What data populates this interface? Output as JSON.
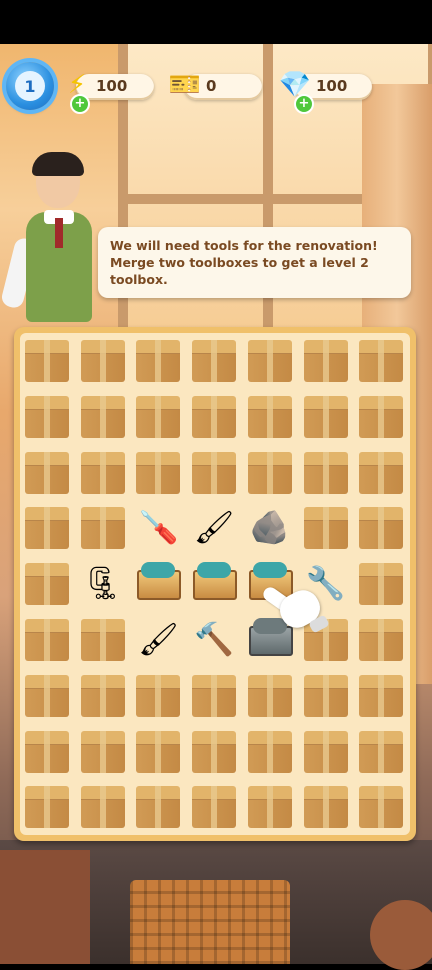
{
  "hud": {
    "level": "1",
    "energy": "100",
    "tickets": "0",
    "gems": "100"
  },
  "dialog": {
    "text": "We will need tools for the renovation! Merge two toolboxes to get a level 2 toolbox."
  },
  "board": {
    "rows": [
      [
        "box",
        "box",
        "box",
        "box",
        "box",
        "box",
        "box"
      ],
      [
        "box",
        "box",
        "box",
        "box",
        "box",
        "box",
        "box"
      ],
      [
        "box",
        "box",
        "box",
        "box",
        "box",
        "box",
        "box"
      ],
      [
        "box",
        "box",
        "screwdriver",
        "brush",
        "stone",
        "box",
        "box"
      ],
      [
        "box",
        "clamp",
        "toolbox",
        "toolbox",
        "toolbox",
        "wrench",
        "box"
      ],
      [
        "box",
        "box",
        "brush",
        "chisel",
        "toolbox-grey",
        "box",
        "box"
      ],
      [
        "box",
        "box",
        "box",
        "box",
        "box",
        "box",
        "box"
      ],
      [
        "box",
        "box",
        "box",
        "box",
        "box",
        "box",
        "box"
      ],
      [
        "box",
        "box",
        "box",
        "box",
        "box",
        "box",
        "box"
      ]
    ],
    "icons": {
      "screwdriver": "🪛",
      "brush": "🖌",
      "stone": "🪨",
      "clamp": "🗜",
      "wrench": "🔧",
      "chisel": "🔨"
    }
  },
  "colors": {
    "level_badge": "#2a8fe0",
    "plus_button": "#4fc83c",
    "board_border": "#f0c06a",
    "bubble_text": "#7a4a22"
  }
}
